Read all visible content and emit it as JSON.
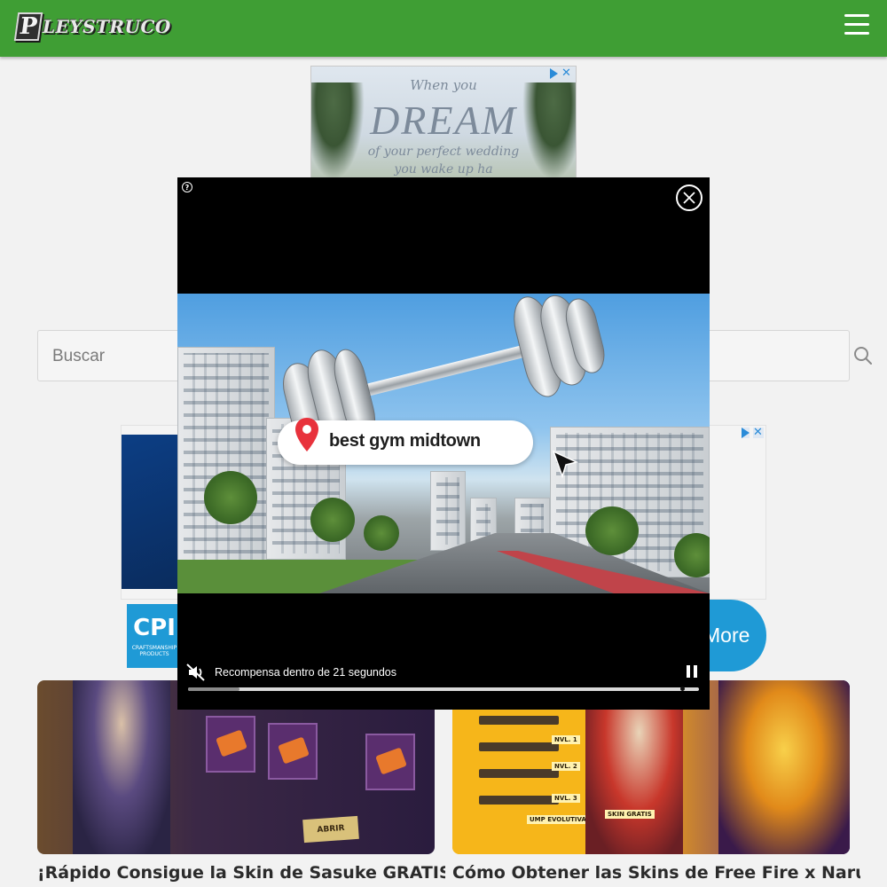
{
  "header": {
    "logo_letter": "P",
    "logo_text": "LEYSTRUCO",
    "menu_icon": "hamburger-menu-icon",
    "background_color": "#3f9e34"
  },
  "ad_top": {
    "line1": "When you",
    "line2": "DREAM",
    "line3": "of your perfect wedding",
    "line4": "you wake up ha",
    "adchoices_icon": "adchoices-icon",
    "close_icon": "close-icon"
  },
  "search": {
    "placeholder": "Buscar",
    "value": "",
    "icon": "search-icon"
  },
  "ad_mid": {
    "logo_text": "CPI",
    "logo_subtext": "CRAFTSMANSHIP PRODUCTS",
    "more_label": "More",
    "accent_color": "#1f9ad6"
  },
  "video_ad": {
    "help_icon": "help-icon",
    "close_icon": "close-icon",
    "search_pill_text": "best gym midtown",
    "reward_text": "Recompensa dentro de 21 segundos",
    "mute_icon": "muted-speaker-icon",
    "pause_icon": "pause-icon",
    "progress": 0.1
  },
  "cards": [
    {
      "title": "¡Rápido Consigue la Skin de Sasuke GRATIS en",
      "image_label": "ABRIR"
    },
    {
      "title": "Cómo Obtener las Skins de Free Fire x Naruto:",
      "image_labels": [
        "SKIN GRATIS",
        "UMP EVOLUTIVA",
        "NVL. 1",
        "NVL. 2",
        "NVL. 3"
      ]
    }
  ]
}
